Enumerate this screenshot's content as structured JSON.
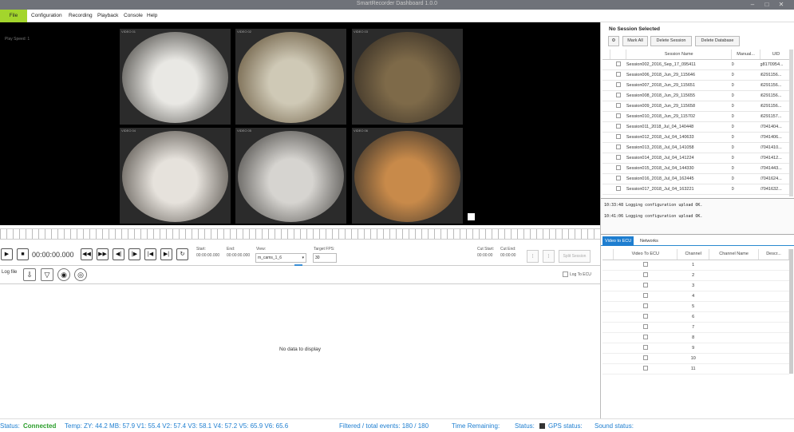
{
  "window": {
    "title": "SmartRecorder Dashboard 1.0.0"
  },
  "menu": {
    "file": "File",
    "configuration": "Configuration",
    "recording": "Recording",
    "playback": "Playback",
    "console": "Console",
    "help": "Help"
  },
  "video": {
    "play_speed": "Play Speed: 1",
    "cameras": [
      {
        "label": "VIDEO 01",
        "colors": [
          "#e9e8e4",
          "#3b3935"
        ]
      },
      {
        "label": "VIDEO 02",
        "colors": [
          "#cfc9b6",
          "#5b4a2f"
        ]
      },
      {
        "label": "VIDEO 03",
        "colors": [
          "#7e6a49",
          "#2e2720"
        ]
      },
      {
        "label": "VIDEO 04",
        "colors": [
          "#e6e2dc",
          "#45403a"
        ]
      },
      {
        "label": "VIDEO 05",
        "colors": [
          "#d6d4d0",
          "#3d3b38"
        ]
      },
      {
        "label": "VIDEO 06",
        "colors": [
          "#c88a4a",
          "#2e2b27"
        ]
      }
    ]
  },
  "transport": {
    "time": "00:00:00.000",
    "start_label": "Start:",
    "start_value": "00:00:00.000",
    "end_label": "End:",
    "end_value": "00:00:00.000",
    "view_label": "View:",
    "view_value": "m_cams_1_6",
    "fps_label": "Target FPS:",
    "fps_value": "30",
    "cut_start_label": "Cut Start:",
    "cut_start_value": "00:00:00",
    "cut_end_label": "Cut End:",
    "cut_end_value": "00:00:00",
    "btn_1": "[",
    "btn_2": "]",
    "split_session": "Split Session"
  },
  "log": {
    "file_label": "Log file",
    "log_to_ecu": "Log To ECU",
    "empty_text": "No data to display"
  },
  "sessions": {
    "title": "No Session Selected",
    "mark_all": "Mark All",
    "delete_session": "Delete Session",
    "delete_database": "Delete Database",
    "columns": [
      "Session Name",
      "Manual...",
      "UID"
    ],
    "rows": [
      {
        "name": "Session002_2016_Sep_17_095411",
        "manual": "0",
        "uid": "g8170954..."
      },
      {
        "name": "Session006_2018_Jun_29_115646",
        "manual": "0",
        "uid": "i6291156..."
      },
      {
        "name": "Session007_2018_Jun_29_115651",
        "manual": "0",
        "uid": "i6291156..."
      },
      {
        "name": "Session008_2018_Jun_29_115655",
        "manual": "0",
        "uid": "i6291156..."
      },
      {
        "name": "Session009_2018_Jun_29_115658",
        "manual": "0",
        "uid": "i6291156..."
      },
      {
        "name": "Session010_2018_Jun_29_115702",
        "manual": "0",
        "uid": "i6291157..."
      },
      {
        "name": "Session011_2018_Jul_04_140448",
        "manual": "0",
        "uid": "i7041404..."
      },
      {
        "name": "Session012_2018_Jul_04_140633",
        "manual": "0",
        "uid": "i7041406..."
      },
      {
        "name": "Session013_2018_Jul_04_141058",
        "manual": "0",
        "uid": "i7041410..."
      },
      {
        "name": "Session014_2018_Jul_04_141224",
        "manual": "0",
        "uid": "i7041412..."
      },
      {
        "name": "Session015_2018_Jul_04_144330",
        "manual": "0",
        "uid": "i7041443..."
      },
      {
        "name": "Session016_2018_Jul_04_162445",
        "manual": "0",
        "uid": "i7041624..."
      },
      {
        "name": "Session017_2018_Jul_04_163221",
        "manual": "0",
        "uid": "i7041632..."
      }
    ]
  },
  "log_panel": {
    "lines": [
      "10:33:48    Logging configuration upload OK.",
      "10:41:06    Logging configuration upload OK."
    ]
  },
  "tabs": {
    "video_to_ecu": "Video to ECU",
    "networks": "Networks"
  },
  "ecu": {
    "columns": [
      "Video To ECU",
      "Channel",
      "Channel Name",
      "Descr..."
    ],
    "channels": [
      "1",
      "2",
      "3",
      "4",
      "5",
      "6",
      "7",
      "8",
      "9",
      "10",
      "11"
    ]
  },
  "status": {
    "status_label": "Status:",
    "status_value": "Connected",
    "temps": "Temp:  ZY: 44.2   MB: 57.9   V1: 55.4   V2: 57.4   V3: 58.1   V4: 57.2   V5: 65.9   V6: 65.6",
    "events": "Filtered / total events: 180 / 180",
    "time_remaining": "Time Remaining:",
    "status2": "Status:",
    "gps": "GPS status:",
    "sound": "Sound status:"
  },
  "colors": {
    "accent": "#1e7ed0",
    "menu_file": "#a3d52c",
    "connected": "#2a9d2a"
  }
}
